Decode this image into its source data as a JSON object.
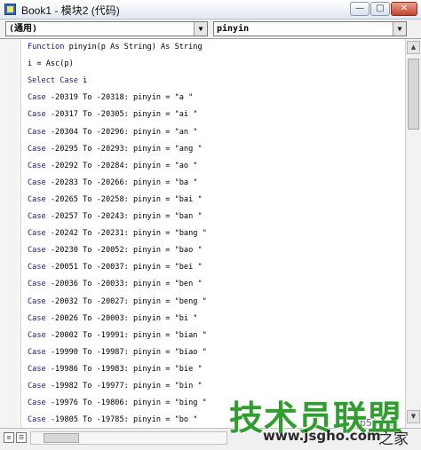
{
  "window": {
    "title": "Book1 - 模块2 (代码)",
    "minimize_glyph": "—",
    "maximize_glyph": "□",
    "close_glyph": "✕"
  },
  "selectors": {
    "object_value": "(通用)",
    "procedure_value": "pinyin",
    "arrow_glyph": "▼"
  },
  "code": {
    "lines": [
      {
        "kw": "Function",
        "rest": " pinyin(p As String) As String"
      },
      {
        "kw": "",
        "rest": "i = Asc(p)"
      },
      {
        "kw": "Select Case",
        "rest": " i"
      },
      {
        "kw": "Case",
        "rest": " -20319 To -20318: pinyin = \"a \""
      },
      {
        "kw": "Case",
        "rest": " -20317 To -20305: pinyin = \"ai \""
      },
      {
        "kw": "Case",
        "rest": " -20304 To -20296: pinyin = \"an \""
      },
      {
        "kw": "Case",
        "rest": " -20295 To -20293: pinyin = \"ang \""
      },
      {
        "kw": "Case",
        "rest": " -20292 To -20284: pinyin = \"ao \""
      },
      {
        "kw": "Case",
        "rest": " -20283 To -20266: pinyin = \"ba \""
      },
      {
        "kw": "Case",
        "rest": " -20265 To -20258: pinyin = \"bai \""
      },
      {
        "kw": "Case",
        "rest": " -20257 To -20243: pinyin = \"ban \""
      },
      {
        "kw": "Case",
        "rest": " -20242 To -20231: pinyin = \"bang \""
      },
      {
        "kw": "Case",
        "rest": " -20230 To -20052: pinyin = \"bao \""
      },
      {
        "kw": "Case",
        "rest": " -20051 To -20037: pinyin = \"bei \""
      },
      {
        "kw": "Case",
        "rest": " -20036 To -20033: pinyin = \"ben \""
      },
      {
        "kw": "Case",
        "rest": " -20032 To -20027: pinyin = \"beng \""
      },
      {
        "kw": "Case",
        "rest": " -20026 To -20003: pinyin = \"bi \""
      },
      {
        "kw": "Case",
        "rest": " -20002 To -19991: pinyin = \"bian \""
      },
      {
        "kw": "Case",
        "rest": " -19990 To -19987: pinyin = \"biao \""
      },
      {
        "kw": "Case",
        "rest": " -19986 To -19983: pinyin = \"bie \""
      },
      {
        "kw": "Case",
        "rest": " -19982 To -19977: pinyin = \"bin \""
      },
      {
        "kw": "Case",
        "rest": " -19976 To -19806: pinyin = \"bing \""
      },
      {
        "kw": "Case",
        "rest": " -19805 To -19785: pinyin = \"bo \""
      }
    ],
    "keyword_color": "#1a1a8c"
  },
  "scrollbar": {
    "up_glyph": "▲",
    "down_glyph": "▼",
    "left_glyph": "◀",
    "right_glyph": "▶"
  },
  "view_buttons": {
    "procedure_view_glyph": "≡",
    "full_module_view_glyph": "☰"
  },
  "watermark": {
    "main": "技术员联盟",
    "site": "www.jsgho.com",
    "suffix": "之家",
    "faint": "jb51.net"
  }
}
